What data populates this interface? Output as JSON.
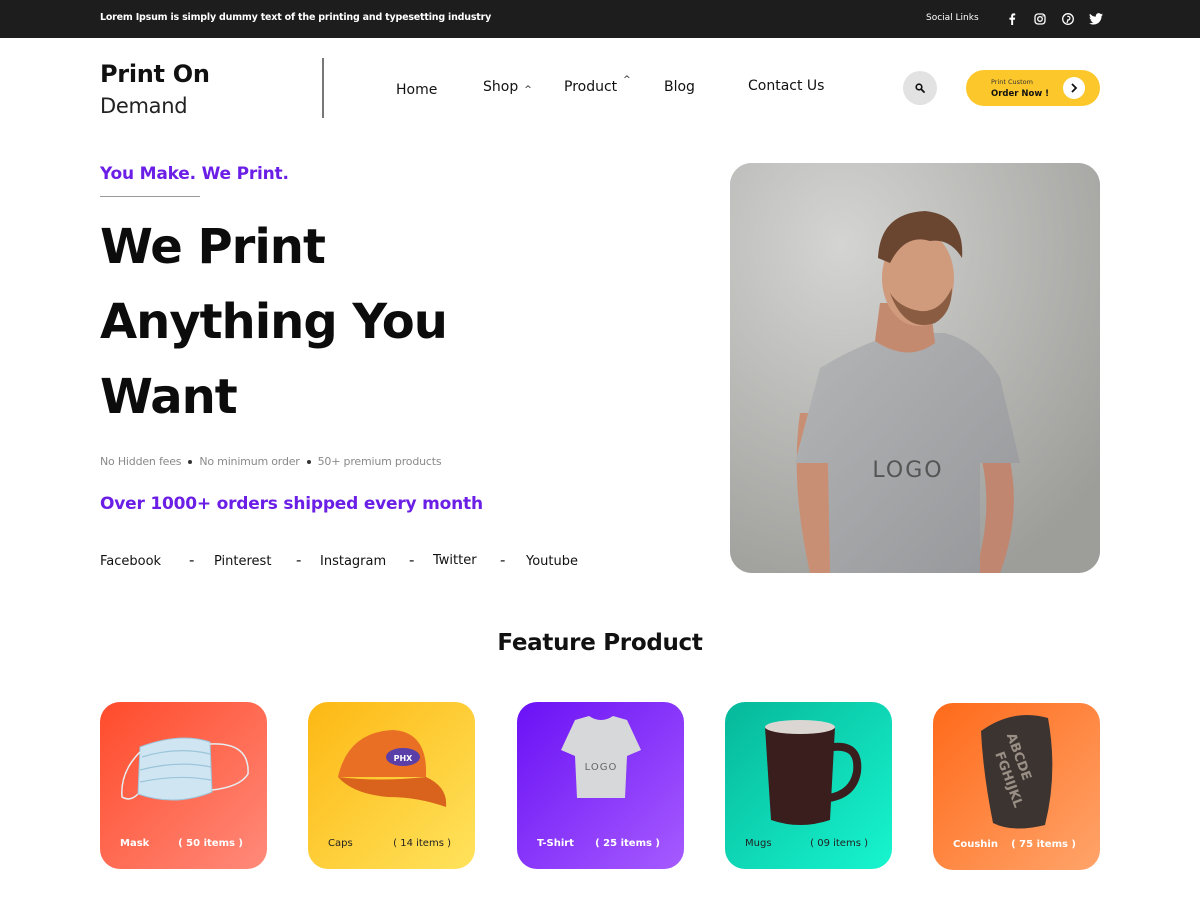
{
  "topbar": {
    "tagline": "Lorem Ipsum is simply dummy text of the printing and typesetting industry",
    "social_label": "Social Links",
    "social_icons": [
      "facebook-icon",
      "instagram-icon",
      "pinterest-icon",
      "twitter-icon"
    ]
  },
  "header": {
    "logo_line1": "Print On",
    "logo_line2": "Demand",
    "nav": [
      {
        "label": "Home",
        "has_chevron": false
      },
      {
        "label": "Shop",
        "has_chevron": true
      },
      {
        "label": "Product",
        "has_chevron": true
      },
      {
        "label": "Blog",
        "has_chevron": false
      },
      {
        "label": "Contact Us",
        "has_chevron": false
      }
    ],
    "search_icon": "search-icon",
    "cta": {
      "small": "Print Custom",
      "label": "Order Now !",
      "icon": "arrow-right-icon"
    },
    "colors": {
      "cta": "#fcc72a",
      "topbar": "#1d1d1d"
    }
  },
  "hero": {
    "kicker": "You Make. We Print.",
    "title_lines": [
      "We Print",
      "Anything You",
      "Want"
    ],
    "perks": [
      "No Hidden fees",
      "No minimum order",
      "50+ premium products"
    ],
    "orders_text": "Over 1000+ orders shipped every month",
    "links": [
      "Facebook",
      "Pinterest",
      "Instagram",
      "Twitter",
      "Youtube"
    ],
    "separator": "-",
    "image_text": "LOGO",
    "accent_color": "#6a1ee6"
  },
  "features": {
    "title": "Feature Product",
    "cards": [
      {
        "name": "Mask",
        "count": "( 50 items )",
        "from": "#ff4b2b",
        "to": "#ff8a7a"
      },
      {
        "name": "Caps",
        "count": "( 14 items )",
        "from": "#fdb813",
        "to": "#ffe35c"
      },
      {
        "name": "T-Shirt",
        "count": "( 25 items )",
        "from": "#6a11f5",
        "to": "#a65bff"
      },
      {
        "name": "Mugs",
        "count": "( 09 items )",
        "from": "#06b89a",
        "to": "#17f5cf"
      },
      {
        "name": "Coushin",
        "count": "( 75 items )",
        "from": "#ff6a1a",
        "to": "#ffa46a"
      }
    ],
    "shirt_logo": "LOGO"
  }
}
